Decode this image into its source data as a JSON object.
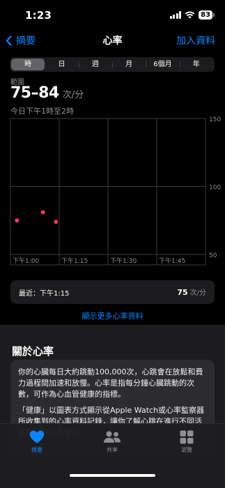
{
  "status": {
    "time": "1:23",
    "battery": "83"
  },
  "nav": {
    "back_label": "摘要",
    "title": "心率",
    "action_label": "加入資料"
  },
  "segments": [
    "時",
    "日",
    "週",
    "月",
    "6個月",
    "年"
  ],
  "active_segment": 0,
  "summary": {
    "range_label": "範圍",
    "range_value": "75–84",
    "range_unit": "次/分",
    "period": "今日下午1時至2時"
  },
  "chart_data": {
    "type": "scatter",
    "x_ticks": [
      "下午1:00",
      "下午1:15",
      "下午1:30",
      "下午1:45"
    ],
    "y_ticks": [
      150,
      100,
      50
    ],
    "ylim": [
      50,
      150
    ],
    "xlim_minutes": [
      0,
      60
    ],
    "grid": true,
    "points": [
      {
        "t": 2,
        "y": 75
      },
      {
        "t": 10,
        "y": 81
      },
      {
        "t": 14,
        "y": 74
      }
    ],
    "point_color": "#ff375f"
  },
  "latest": {
    "label": "最近：下午1:15",
    "value": "75",
    "unit": "次/分"
  },
  "more_link": "顯示更多心率資料",
  "about": {
    "title": "關於心率",
    "para1": "你的心臟每日大約跳動100,000次，心跳會在放鬆和費力過程間加速和放慢。心率是指每分鐘心臟跳動的次數，可作為心血管健康的指標。",
    "para2": "「健康」以圖表方式顯示從Apple Watch或心率監察器所收集到的心率資料記錄，讓你了解心跳在進行不同活動時的模式與變化。"
  },
  "tabs": [
    {
      "label": "摘要",
      "icon": "heart-icon"
    },
    {
      "label": "共享",
      "icon": "people-icon"
    },
    {
      "label": "瀏覽",
      "icon": "grid-icon"
    }
  ],
  "colors": {
    "accent": "#0a84ff",
    "heart_point": "#ff375f"
  }
}
